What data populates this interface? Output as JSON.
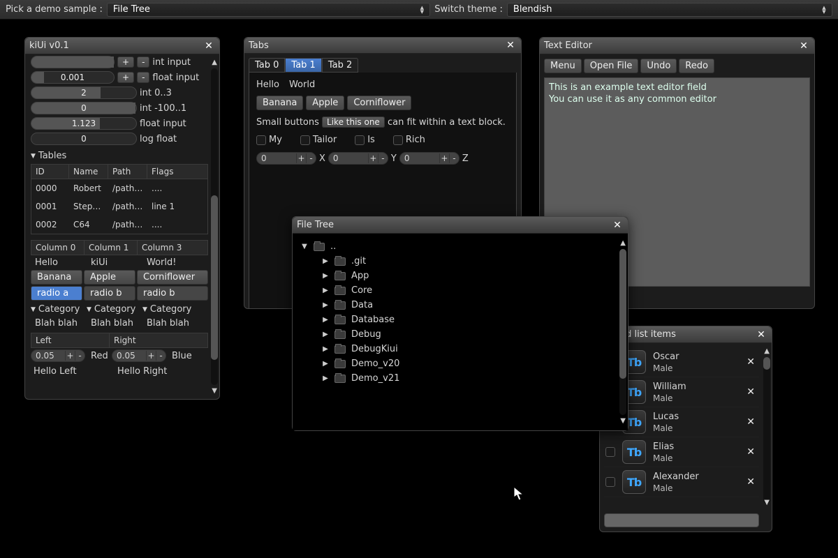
{
  "topbar": {
    "demo_label": "Pick a demo sample :",
    "demo_value": "File Tree",
    "theme_label": "Switch theme :",
    "theme_value": "Blendish"
  },
  "win_kiui": {
    "title": "kiUi v0.1",
    "int_input_label": "int input",
    "float_input_label": "float input",
    "float_input_value": "0.001",
    "int03_label": "int 0..3",
    "int03_value": "2",
    "int100_label": "int -100..1",
    "int100_value": "0",
    "float_in2_label": "float input",
    "float_in2_value": "1.123",
    "logfloat_label": "log float",
    "logfloat_value": "0",
    "tables_label": "Tables",
    "t1_headers": [
      "ID",
      "Name",
      "Path",
      "Flags"
    ],
    "t1_rows": [
      [
        "0000",
        "Robert",
        "/path/rob",
        "...."
      ],
      [
        "0001",
        "Stephani",
        "/path/ste",
        "line 1"
      ],
      [
        "0002",
        "C64",
        "/path/cor",
        "...."
      ]
    ],
    "t2_headers": [
      "Column 0",
      "Column 1",
      "Column 3"
    ],
    "t2_text_row": [
      "Hello",
      "kiUi",
      "World!"
    ],
    "t2_btn_row": [
      "Banana",
      "Apple",
      "Corniflower"
    ],
    "t2_radio_row": [
      "radio a",
      "radio b",
      "radio b"
    ],
    "t2_cat_row": [
      "Category",
      "Category",
      "Category"
    ],
    "t2_blah_row": [
      "Blah blah",
      "Blah blah",
      "Blah blah"
    ],
    "lr_headers": [
      "Left",
      "Right"
    ],
    "lr_val1": "0.05",
    "lr_red": "Red",
    "lr_val2": "0.05",
    "lr_blue": "Blue",
    "lr_hello1": "Hello Left",
    "lr_hello2": "Hello Right"
  },
  "win_tabs": {
    "title": "Tabs",
    "tabs": [
      "Tab 0",
      "Tab 1",
      "Tab 2"
    ],
    "active_tab": 1,
    "hello": "Hello",
    "world": "World",
    "pills": [
      "Banana",
      "Apple",
      "Corniflower"
    ],
    "sentence_pre": "Small buttons ",
    "sentence_btn": "Like this one",
    "sentence_post": " can fit within a text block.",
    "chk_labels": [
      "My",
      "Tailor",
      "Is",
      "Rich"
    ],
    "xyz_labels": [
      "X",
      "Y",
      "Z"
    ],
    "xyz_value": "0"
  },
  "win_text": {
    "title": "Text Editor",
    "menu": [
      "Menu",
      "Open File",
      "Undo",
      "Redo"
    ],
    "content": "This is an example text editor field\nYou can use it as any common editor"
  },
  "win_tree": {
    "title": "File Tree",
    "root": "..",
    "items": [
      ".git",
      "App",
      "Core",
      "Data",
      "Database",
      "Debug",
      "DebugKiui",
      "Demo_v20",
      "Demo_v21"
    ]
  },
  "win_list": {
    "title": "mized list items",
    "items": [
      {
        "name": "Oscar",
        "sub": "Male"
      },
      {
        "name": "William",
        "sub": "Male"
      },
      {
        "name": "Lucas",
        "sub": "Male"
      },
      {
        "name": "Elias",
        "sub": "Male"
      },
      {
        "name": "Alexander",
        "sub": "Male"
      }
    ]
  }
}
